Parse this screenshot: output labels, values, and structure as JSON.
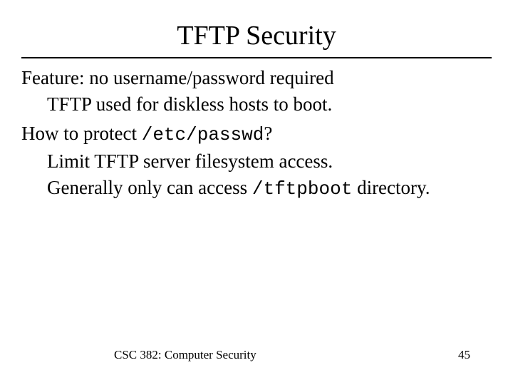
{
  "slide": {
    "title": "TFTP Security",
    "lines": {
      "feature": "Feature: no username/password required",
      "feature_sub": "TFTP used for diskless hosts to boot.",
      "protect_pre": "How to protect ",
      "protect_code": "/etc/passwd",
      "protect_post": "?",
      "limit": "Limit TFTP server filesystem access.",
      "access_pre": "Generally only can access ",
      "access_code": "/tftpboot",
      "access_post": " directory."
    },
    "footer": {
      "course": "CSC 382: Computer Security",
      "page": "45"
    }
  }
}
